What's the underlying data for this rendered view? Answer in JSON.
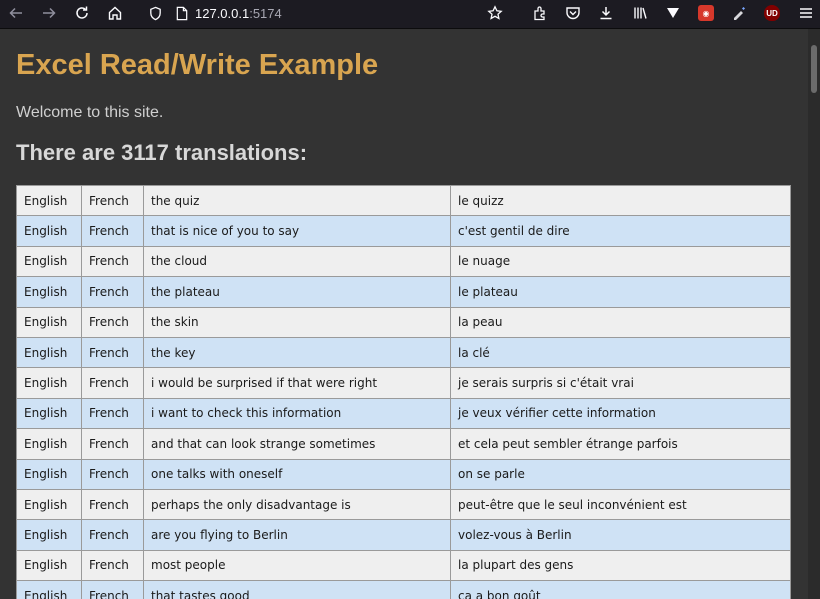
{
  "browser": {
    "url_host": "127.0.0.1",
    "url_port": ":5174",
    "ublock_badge": "UD"
  },
  "page": {
    "title": "Excel Read/Write Example",
    "welcome": "Welcome to this site.",
    "count_heading": "There are 3117 translations:"
  },
  "colors": {
    "title": "#d9a550",
    "background": "#333333",
    "row_odd": "#efefef",
    "row_even": "#cfe2f5"
  },
  "rows": [
    {
      "from": "English",
      "to": "French",
      "source": "the quiz",
      "target": "le quizz"
    },
    {
      "from": "English",
      "to": "French",
      "source": "that is nice of you to say",
      "target": "c'est gentil de dire"
    },
    {
      "from": "English",
      "to": "French",
      "source": "the cloud",
      "target": "le nuage"
    },
    {
      "from": "English",
      "to": "French",
      "source": "the plateau",
      "target": "le plateau"
    },
    {
      "from": "English",
      "to": "French",
      "source": "the skin",
      "target": "la peau"
    },
    {
      "from": "English",
      "to": "French",
      "source": "the key",
      "target": "la clé"
    },
    {
      "from": "English",
      "to": "French",
      "source": "i would be surprised if that were right",
      "target": "je serais surpris si c'était vrai"
    },
    {
      "from": "English",
      "to": "French",
      "source": "i want to check this information",
      "target": "je veux vérifier cette information"
    },
    {
      "from": "English",
      "to": "French",
      "source": "and that can look strange sometimes",
      "target": "et cela peut sembler étrange parfois"
    },
    {
      "from": "English",
      "to": "French",
      "source": "one talks with oneself",
      "target": "on se parle"
    },
    {
      "from": "English",
      "to": "French",
      "source": "perhaps the only disadvantage is",
      "target": "peut-être que le seul inconvénient est"
    },
    {
      "from": "English",
      "to": "French",
      "source": "are you flying to Berlin",
      "target": "volez-vous à Berlin"
    },
    {
      "from": "English",
      "to": "French",
      "source": "most people",
      "target": "la plupart des gens"
    },
    {
      "from": "English",
      "to": "French",
      "source": "that tastes good",
      "target": "ça a bon goût"
    }
  ]
}
